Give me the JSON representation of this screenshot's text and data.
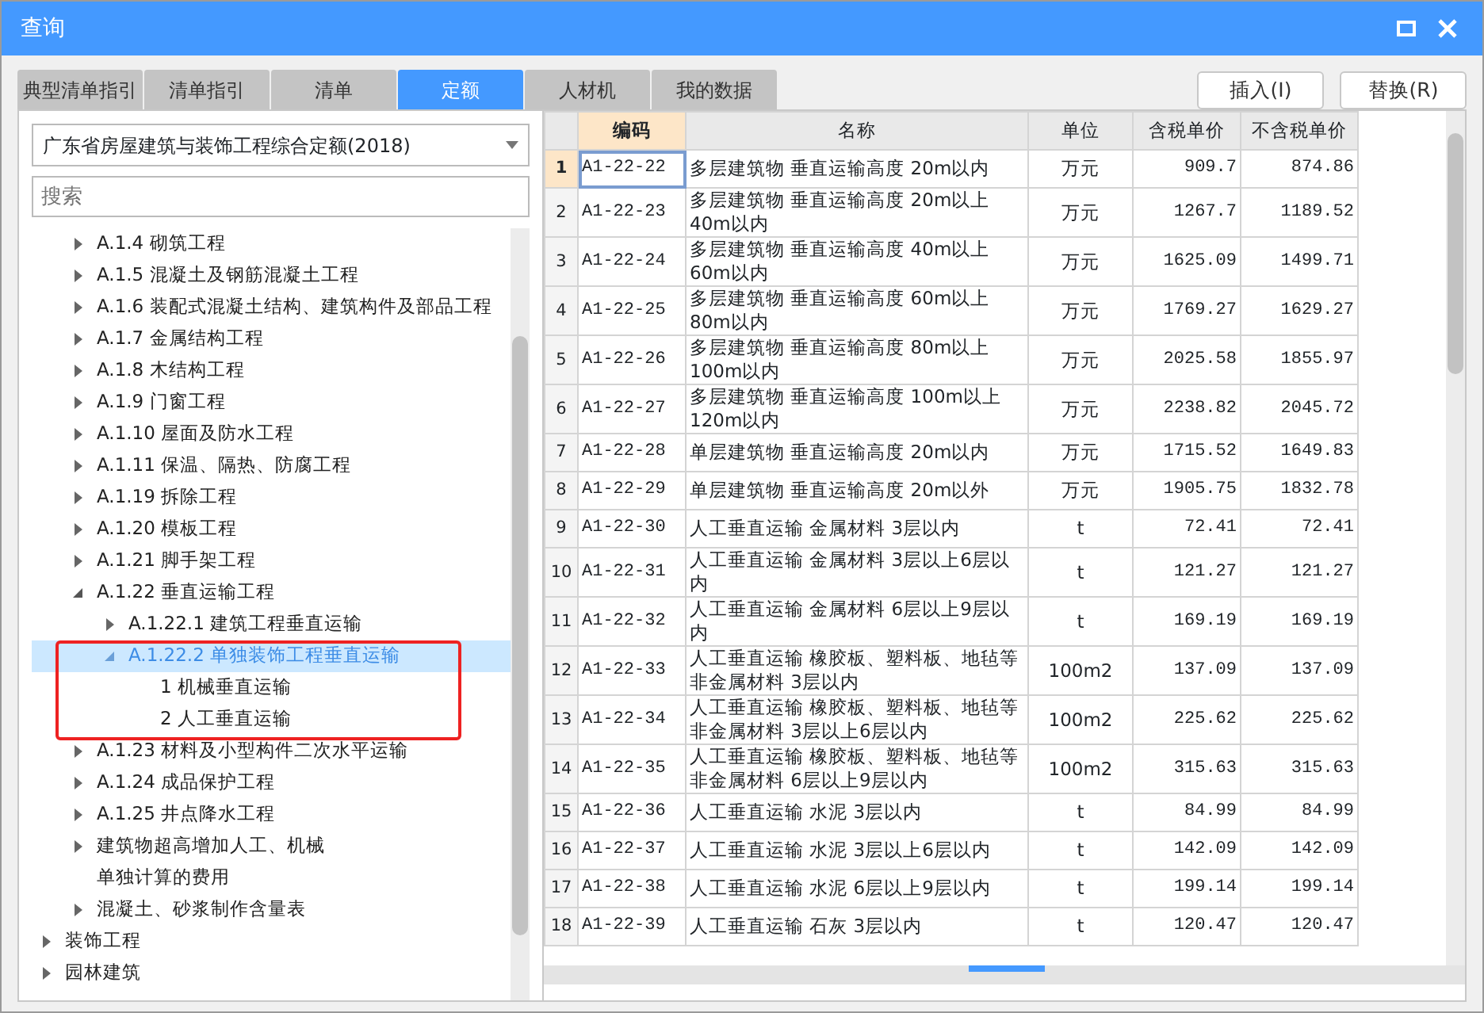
{
  "window": {
    "title": "查询"
  },
  "tabs": [
    {
      "label": "典型清单指引",
      "selected": false
    },
    {
      "label": "清单指引",
      "selected": false
    },
    {
      "label": "清单",
      "selected": false
    },
    {
      "label": "定额",
      "selected": true
    },
    {
      "label": "人材机",
      "selected": false
    },
    {
      "label": "我的数据",
      "selected": false
    }
  ],
  "actions": [
    "插入(I)",
    "替换(R)"
  ],
  "library": {
    "value": "广东省房屋建筑与装饰工程综合定额(2018)"
  },
  "search": {
    "placeholder": "搜索"
  },
  "tree": [
    {
      "kind": "offscreen",
      "children": [
        {
          "label": "A.1.4 砌筑工程",
          "kind": "branch",
          "expanded": false
        },
        {
          "label": "A.1.5 混凝土及钢筋混凝土工程",
          "kind": "branch",
          "expanded": false
        },
        {
          "label": "A.1.6 装配式混凝土结构、建筑构件及部品工程",
          "kind": "branch",
          "expanded": false
        },
        {
          "label": "A.1.7 金属结构工程",
          "kind": "branch",
          "expanded": false
        },
        {
          "label": "A.1.8 木结构工程",
          "kind": "branch",
          "expanded": false
        },
        {
          "label": "A.1.9 门窗工程",
          "kind": "branch",
          "expanded": false
        },
        {
          "label": "A.1.10 屋面及防水工程",
          "kind": "branch",
          "expanded": false
        },
        {
          "label": "A.1.11 保温、隔热、防腐工程",
          "kind": "branch",
          "expanded": false
        },
        {
          "label": "A.1.19 拆除工程",
          "kind": "branch",
          "expanded": false
        },
        {
          "label": "A.1.20 模板工程",
          "kind": "branch",
          "expanded": false
        },
        {
          "label": "A.1.21 脚手架工程",
          "kind": "branch",
          "expanded": false
        },
        {
          "label": "A.1.22 垂直运输工程",
          "kind": "branch",
          "expanded": true,
          "children": [
            {
              "label": "A.1.22.1 建筑工程垂直运输",
              "kind": "branch",
              "expanded": false
            },
            {
              "label": "A.1.22.2 单独装饰工程垂直运输",
              "kind": "branch",
              "expanded": true,
              "selected": true,
              "highlight": true,
              "children": [
                {
                  "label": "1 机械垂直运输",
                  "kind": "leaf"
                },
                {
                  "label": "2 人工垂直运输",
                  "kind": "leaf"
                }
              ]
            }
          ]
        },
        {
          "label": "A.1.23 材料及小型构件二次水平运输",
          "kind": "branch",
          "expanded": false
        },
        {
          "label": "A.1.24 成品保护工程",
          "kind": "branch",
          "expanded": false
        },
        {
          "label": "A.1.25 井点降水工程",
          "kind": "branch",
          "expanded": false
        },
        {
          "label": "建筑物超高增加人工、机械",
          "kind": "branch",
          "expanded": false
        },
        {
          "label": "单独计算的费用",
          "kind": "leaf"
        },
        {
          "label": "混凝土、砂浆制作含量表",
          "kind": "branch",
          "expanded": false
        }
      ]
    },
    {
      "label": "装饰工程",
      "kind": "branch",
      "expanded": false
    },
    {
      "label": "园林建筑",
      "kind": "branch",
      "expanded": false
    }
  ],
  "table": {
    "columns": [
      {
        "label": "编码",
        "active": true
      },
      {
        "label": "名称",
        "active": false
      },
      {
        "label": "单位",
        "active": false
      },
      {
        "label": "含税单价",
        "active": false
      },
      {
        "label": "不含税单价",
        "active": false
      }
    ],
    "rows": [
      {
        "no": "1",
        "selected": true,
        "cells": [
          "A1-22-22",
          "多层建筑物 垂直运输高度 20m以内",
          "万元",
          "909.7",
          "874.86"
        ]
      },
      {
        "no": "2",
        "selected": false,
        "cells": [
          "A1-22-23",
          "多层建筑物 垂直运输高度 20m以上40m以内",
          "万元",
          "1267.7",
          "1189.52"
        ]
      },
      {
        "no": "3",
        "selected": false,
        "cells": [
          "A1-22-24",
          "多层建筑物 垂直运输高度 40m以上60m以内",
          "万元",
          "1625.09",
          "1499.71"
        ]
      },
      {
        "no": "4",
        "selected": false,
        "cells": [
          "A1-22-25",
          "多层建筑物 垂直运输高度 60m以上80m以内",
          "万元",
          "1769.27",
          "1629.27"
        ]
      },
      {
        "no": "5",
        "selected": false,
        "cells": [
          "A1-22-26",
          "多层建筑物 垂直运输高度 80m以上100m以内",
          "万元",
          "2025.58",
          "1855.97"
        ]
      },
      {
        "no": "6",
        "selected": false,
        "cells": [
          "A1-22-27",
          "多层建筑物 垂直运输高度 100m以上120m以内",
          "万元",
          "2238.82",
          "2045.72"
        ]
      },
      {
        "no": "7",
        "selected": false,
        "cells": [
          "A1-22-28",
          "单层建筑物 垂直运输高度 20m以内",
          "万元",
          "1715.52",
          "1649.83"
        ]
      },
      {
        "no": "8",
        "selected": false,
        "cells": [
          "A1-22-29",
          "单层建筑物 垂直运输高度 20m以外",
          "万元",
          "1905.75",
          "1832.78"
        ]
      },
      {
        "no": "9",
        "selected": false,
        "cells": [
          "A1-22-30",
          "人工垂直运输 金属材料 3层以内",
          "t",
          "72.41",
          "72.41"
        ]
      },
      {
        "no": "10",
        "selected": false,
        "cells": [
          "A1-22-31",
          "人工垂直运输 金属材料 3层以上6层以内",
          "t",
          "121.27",
          "121.27"
        ]
      },
      {
        "no": "11",
        "selected": false,
        "cells": [
          "A1-22-32",
          "人工垂直运输 金属材料 6层以上9层以内",
          "t",
          "169.19",
          "169.19"
        ]
      },
      {
        "no": "12",
        "selected": false,
        "cells": [
          "A1-22-33",
          "人工垂直运输 橡胶板、塑料板、地毡等非金属材料 3层以内",
          "100m2",
          "137.09",
          "137.09"
        ]
      },
      {
        "no": "13",
        "selected": false,
        "cells": [
          "A1-22-34",
          "人工垂直运输 橡胶板、塑料板、地毡等非金属材料 3层以上6层以内",
          "100m2",
          "225.62",
          "225.62"
        ]
      },
      {
        "no": "14",
        "selected": false,
        "cells": [
          "A1-22-35",
          "人工垂直运输 橡胶板、塑料板、地毡等非金属材料 6层以上9层以内",
          "100m2",
          "315.63",
          "315.63"
        ]
      },
      {
        "no": "15",
        "selected": false,
        "cells": [
          "A1-22-36",
          "人工垂直运输 水泥 3层以内",
          "t",
          "84.99",
          "84.99"
        ]
      },
      {
        "no": "16",
        "selected": false,
        "cells": [
          "A1-22-37",
          "人工垂直运输 水泥 3层以上6层以内",
          "t",
          "142.09",
          "142.09"
        ]
      },
      {
        "no": "17",
        "selected": false,
        "cells": [
          "A1-22-38",
          "人工垂直运输 水泥 6层以上9层以内",
          "t",
          "199.14",
          "199.14"
        ]
      },
      {
        "no": "18",
        "selected": false,
        "cells": [
          "A1-22-39",
          "人工垂直运输 石灰 3层以内",
          "t",
          "120.47",
          "120.47"
        ]
      }
    ]
  }
}
